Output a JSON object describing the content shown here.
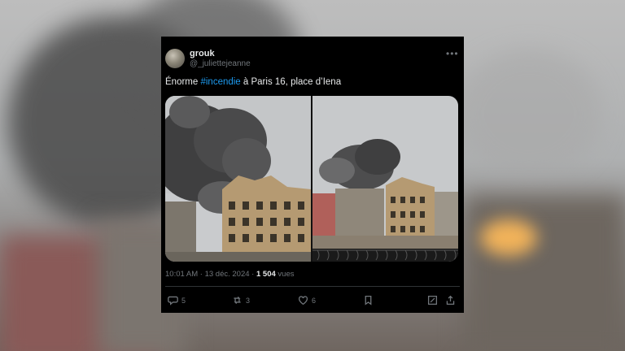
{
  "tweet": {
    "author_name": "grouk",
    "author_handle": "@_juliettejeanne",
    "text_before": "Énorme ",
    "hashtag": "#incendie",
    "text_after": " à Paris 16, place d’Iena",
    "time": "10:01 AM",
    "date": "13 déc. 2024",
    "views_count": "1 504",
    "views_label": "vues",
    "replies": "5",
    "reposts": "3",
    "likes": "6"
  },
  "icons": {
    "more": "more-horizontal-icon",
    "reply": "speech-bubble-icon",
    "repost": "repost-arrows-icon",
    "like": "heart-icon",
    "bookmark": "bookmark-icon",
    "edit": "edit-square-icon",
    "share": "share-upload-icon"
  },
  "colors": {
    "card_bg": "#000000",
    "text": "#e7e9ea",
    "muted": "#71767b",
    "link": "#1d9bf0"
  }
}
